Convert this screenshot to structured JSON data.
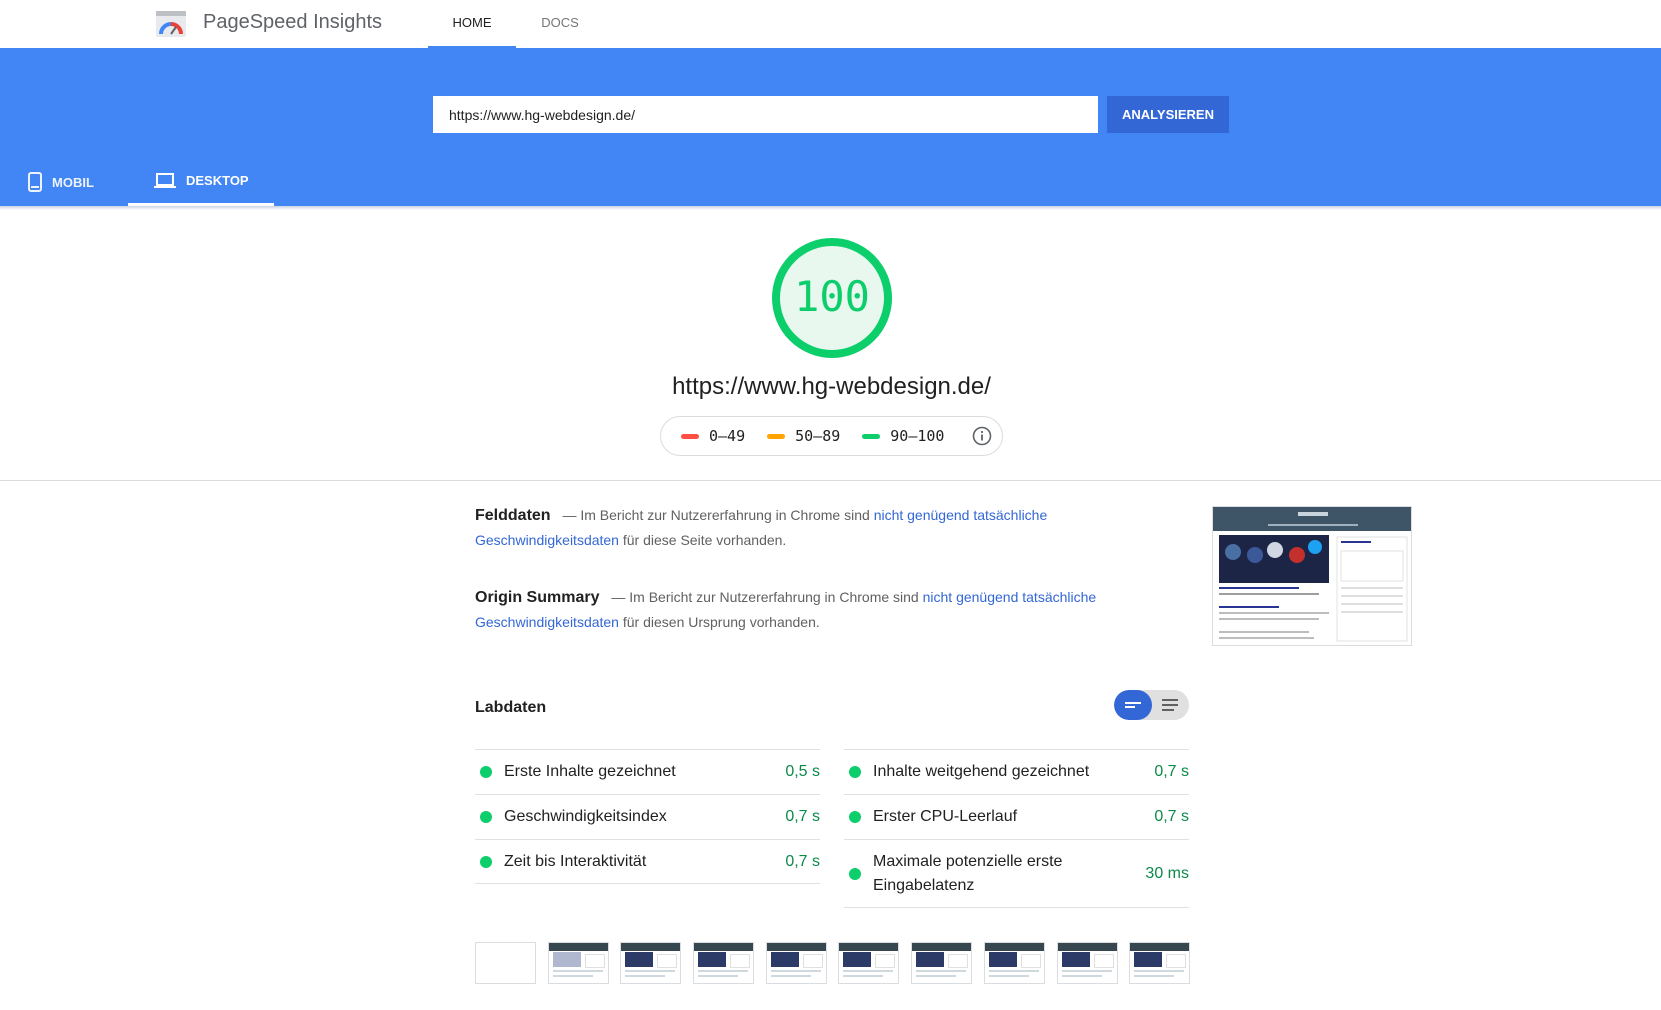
{
  "app": {
    "title": "PageSpeed Insights"
  },
  "nav": {
    "tabs": [
      {
        "label": "HOME"
      },
      {
        "label": "DOCS"
      }
    ]
  },
  "search": {
    "value": "https://www.hg-webdesign.de/",
    "analyze_label": "ANALYSIEREN"
  },
  "device_tabs": [
    {
      "label": "MOBIL"
    },
    {
      "label": "DESKTOP",
      "active": true
    }
  ],
  "score": {
    "value": "100",
    "url": "https://www.hg-webdesign.de/",
    "color": "#0cce6b"
  },
  "legend": [
    {
      "label": "0–49",
      "color": "#ff4e42"
    },
    {
      "label": "50–89",
      "color": "#ffa400"
    },
    {
      "label": "90–100",
      "color": "#0cce6b"
    }
  ],
  "field_data": {
    "title": "Felddaten",
    "text_before": "— Im Bericht zur Nutzererfahrung in Chrome sind",
    "link": "nicht genügend tatsächliche Geschwindigkeitsdaten",
    "text_after": "für diese Seite vorhanden."
  },
  "origin_summary": {
    "title": "Origin Summary",
    "text_before": "— Im Bericht zur Nutzererfahrung in Chrome sind",
    "link": "nicht genügend tatsächliche Geschwindigkeitsdaten",
    "text_after": "für diesen Ursprung vorhanden."
  },
  "lab_data": {
    "title": "Labdaten",
    "left": [
      {
        "label": "Erste Inhalte gezeichnet",
        "value": "0,5 s"
      },
      {
        "label": "Geschwindigkeitsindex",
        "value": "0,7 s"
      },
      {
        "label": "Zeit bis Interaktivität",
        "value": "0,7 s"
      }
    ],
    "right": [
      {
        "label": "Inhalte weitgehend gezeichnet",
        "value": "0,7 s"
      },
      {
        "label": "Erster CPU-Leerlauf",
        "value": "0,7 s"
      },
      {
        "label": "Maximale potenzielle erste Eingabelatenz",
        "value": "30 ms"
      }
    ]
  }
}
